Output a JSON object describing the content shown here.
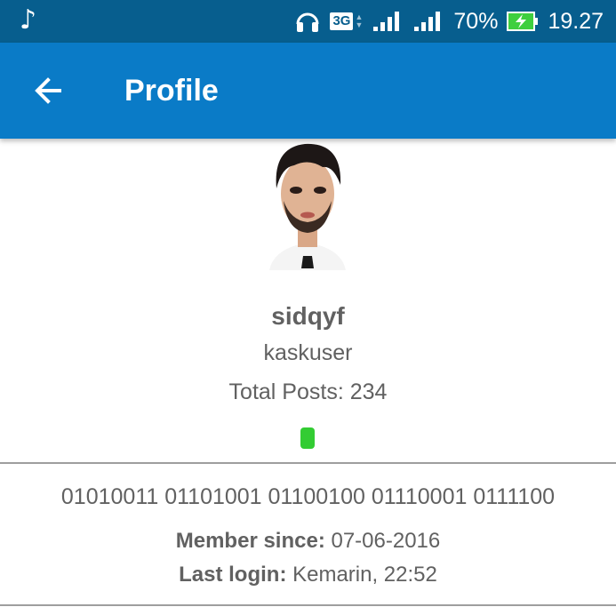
{
  "status_bar": {
    "music_icon": "music-note-icon",
    "network_type": "3G",
    "battery_percent": "70%",
    "time": "19.27"
  },
  "app_bar": {
    "title": "Profile",
    "back_icon": "arrow-left-icon"
  },
  "profile": {
    "username": "sidqyf",
    "user_title": "kaskuser",
    "total_posts": "Total Posts: 234",
    "online_color": "#33cc33",
    "bio": "01010011 01101001 01100100 01110001 0111100",
    "member_since_label": "Member since:",
    "member_since_value": " 07-06-2016",
    "last_login_label": "Last login:",
    "last_login_value": " Kemarin, 22:52"
  },
  "colors": {
    "status_bar": "#075e8e",
    "app_bar": "#0a7bc7",
    "text": "#616161"
  }
}
